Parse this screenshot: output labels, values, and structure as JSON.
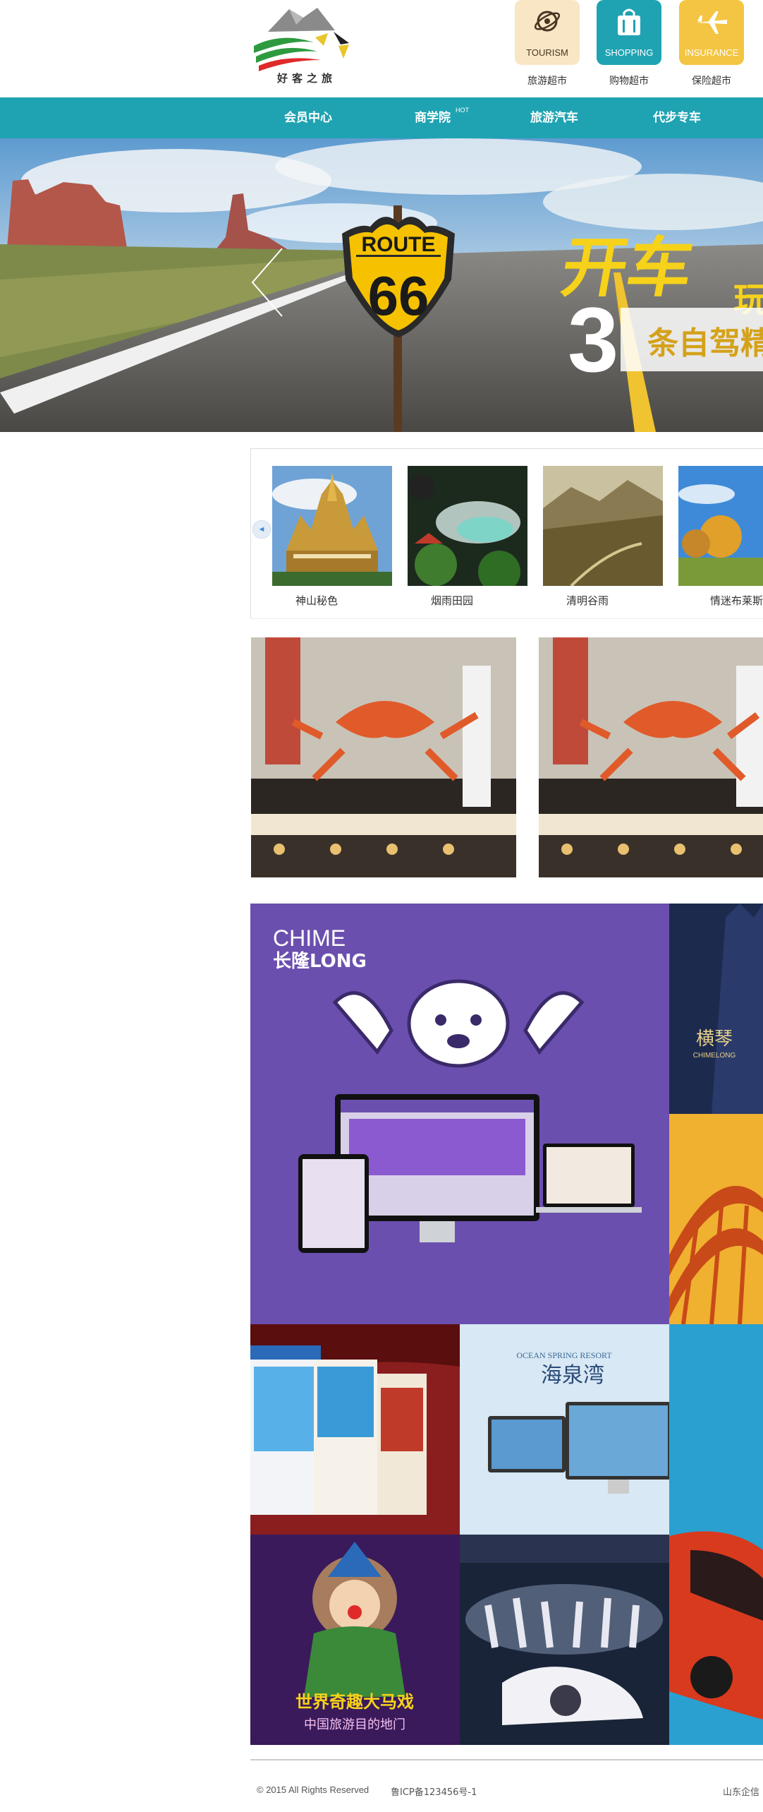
{
  "header": {
    "logo_caption": "好客之旅",
    "quick_links": [
      {
        "badge": "TOURISM",
        "label": "旅游超市",
        "icon": "globe-icon",
        "color": "#f8e6c4"
      },
      {
        "badge": "SHOPPING",
        "label": "购物超市",
        "icon": "shopping-bag-icon",
        "color": "#1fa3b2"
      },
      {
        "badge": "INSURANCE",
        "label": "保险超市",
        "icon": "airplane-icon",
        "color": "#f4c542"
      }
    ]
  },
  "nav": {
    "items": [
      {
        "label": "会员中心"
      },
      {
        "label": "商学院",
        "badge": "HOT"
      },
      {
        "label": "旅游汽车"
      },
      {
        "label": "代步专车"
      }
    ]
  },
  "banner": {
    "sign_top": "ROUTE",
    "sign_number": "66",
    "headline_1": "开车",
    "headline_2": "玩",
    "big_number": "3",
    "subline": "条自驾精"
  },
  "carousel": {
    "prev_glyph": "◄",
    "items": [
      {
        "caption": "神山秘色"
      },
      {
        "caption": "烟雨田园"
      },
      {
        "caption": "清明谷雨"
      },
      {
        "caption": "情迷布莱斯"
      }
    ]
  },
  "mosaic": {
    "chimelong_brand_1": "CHIME",
    "chimelong_brand_2": "长隆LONG",
    "hengqin": "横琴",
    "hengqin_sub": "CHIMELONG",
    "haiquanwan": "海泉湾",
    "haiquanwan_sub": "OCEAN SPRING RESORT",
    "circus_text": "世界奇趣大马戏",
    "circus_sub": "中国旅游目的地门"
  },
  "footer": {
    "copyright": "© 2015 All Rights Reserved",
    "icp": "鲁ICP备123456号-1",
    "right": "山东企信"
  },
  "colors": {
    "accent": "#1fa3b2",
    "purple": "#6b4fae"
  }
}
